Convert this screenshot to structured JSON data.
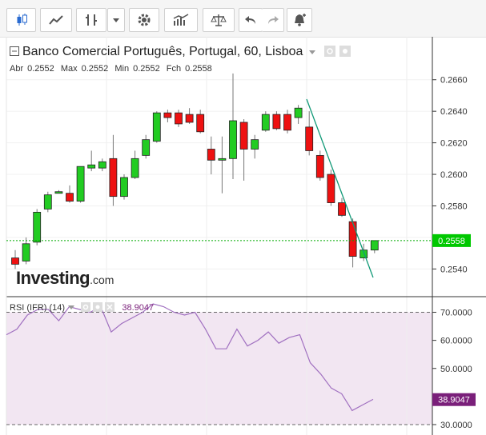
{
  "toolbar": {
    "buttons": [
      {
        "name": "candlestick-icon"
      },
      {
        "name": "line-chart-icon"
      },
      {
        "name": "bar-type-icon"
      },
      {
        "name": "chevron-down-icon"
      },
      {
        "name": "gear-icon"
      },
      {
        "name": "indicators-icon"
      },
      {
        "name": "scale-icon"
      },
      {
        "name": "undo-icon"
      },
      {
        "name": "redo-icon"
      },
      {
        "name": "alert-bell-icon"
      }
    ]
  },
  "header": {
    "title": "Banco Comercial Português, Portugal, 60, Lisboa",
    "ohlc": {
      "open_label": "Abr",
      "open": "0.2552",
      "high_label": "Max",
      "high": "0.2552",
      "low_label": "Min",
      "low": "0.2552",
      "close_label": "Fch",
      "close": "0.2558"
    }
  },
  "logo": {
    "text": "Investing",
    "suffix": ".com"
  },
  "rsi": {
    "label": "RSI (IFR) (14)",
    "value": "38.9047"
  },
  "colors": {
    "up": "#22cc22",
    "down": "#ee1111",
    "rsi_line": "#a070c0",
    "rsi_band": "#f2e6f2",
    "price_line": "#00aa00",
    "trend_line": "#119977",
    "rsi_badge": "#7a1f7a",
    "price_badge": "#00c800"
  },
  "chart_data": [
    {
      "type": "candlestick",
      "title": "Banco Comercial Português, Portugal, 60, Lisboa",
      "ylim": [
        0.2527,
        0.267
      ],
      "yticks": [
        "0.2540",
        "0.2560",
        "0.2580",
        "0.2600",
        "0.2620",
        "0.2640",
        "0.2660"
      ],
      "current_price": "0.2558",
      "candles": [
        {
          "o": 0.2547,
          "h": 0.2552,
          "l": 0.254,
          "c": 0.2543
        },
        {
          "o": 0.2545,
          "h": 0.256,
          "l": 0.2543,
          "c": 0.2556
        },
        {
          "o": 0.2557,
          "h": 0.2578,
          "l": 0.2555,
          "c": 0.2576
        },
        {
          "o": 0.2578,
          "h": 0.2589,
          "l": 0.2576,
          "c": 0.2587
        },
        {
          "o": 0.2589,
          "h": 0.259,
          "l": 0.2588,
          "c": 0.2589
        },
        {
          "o": 0.2588,
          "h": 0.2593,
          "l": 0.2582,
          "c": 0.2583
        },
        {
          "o": 0.2583,
          "h": 0.2605,
          "l": 0.2582,
          "c": 0.2605
        },
        {
          "o": 0.2604,
          "h": 0.2615,
          "l": 0.2602,
          "c": 0.2606
        },
        {
          "o": 0.2604,
          "h": 0.261,
          "l": 0.2602,
          "c": 0.2608
        },
        {
          "o": 0.261,
          "h": 0.2625,
          "l": 0.258,
          "c": 0.2586
        },
        {
          "o": 0.2586,
          "h": 0.26,
          "l": 0.2584,
          "c": 0.2598
        },
        {
          "o": 0.2598,
          "h": 0.2615,
          "l": 0.2597,
          "c": 0.261
        },
        {
          "o": 0.2612,
          "h": 0.2625,
          "l": 0.261,
          "c": 0.2622
        },
        {
          "o": 0.2621,
          "h": 0.264,
          "l": 0.262,
          "c": 0.2639
        },
        {
          "o": 0.2639,
          "h": 0.2641,
          "l": 0.2633,
          "c": 0.2636
        },
        {
          "o": 0.2639,
          "h": 0.2641,
          "l": 0.263,
          "c": 0.2632
        },
        {
          "o": 0.2638,
          "h": 0.2642,
          "l": 0.2632,
          "c": 0.2633
        },
        {
          "o": 0.2638,
          "h": 0.2641,
          "l": 0.2626,
          "c": 0.2627
        },
        {
          "o": 0.2616,
          "h": 0.2624,
          "l": 0.26,
          "c": 0.2609
        },
        {
          "o": 0.2609,
          "h": 0.2624,
          "l": 0.2588,
          "c": 0.261
        },
        {
          "o": 0.261,
          "h": 0.2664,
          "l": 0.2597,
          "c": 0.2634
        },
        {
          "o": 0.2633,
          "h": 0.2635,
          "l": 0.2596,
          "c": 0.2616
        },
        {
          "o": 0.2616,
          "h": 0.2625,
          "l": 0.261,
          "c": 0.2622
        },
        {
          "o": 0.2628,
          "h": 0.264,
          "l": 0.2627,
          "c": 0.2638
        },
        {
          "o": 0.2638,
          "h": 0.264,
          "l": 0.2628,
          "c": 0.2629
        },
        {
          "o": 0.2638,
          "h": 0.2641,
          "l": 0.2626,
          "c": 0.2628
        },
        {
          "o": 0.2636,
          "h": 0.2644,
          "l": 0.2632,
          "c": 0.2642
        },
        {
          "o": 0.263,
          "h": 0.264,
          "l": 0.2612,
          "c": 0.2615
        },
        {
          "o": 0.2612,
          "h": 0.2615,
          "l": 0.2596,
          "c": 0.2598
        },
        {
          "o": 0.26,
          "h": 0.2603,
          "l": 0.258,
          "c": 0.2582
        },
        {
          "o": 0.2582,
          "h": 0.2585,
          "l": 0.2573,
          "c": 0.2574
        },
        {
          "o": 0.257,
          "h": 0.2572,
          "l": 0.2541,
          "c": 0.2548
        },
        {
          "o": 0.2547,
          "h": 0.2556,
          "l": 0.2545,
          "c": 0.2552
        },
        {
          "o": 0.2552,
          "h": 0.2558,
          "l": 0.255,
          "c": 0.2558
        }
      ]
    },
    {
      "type": "line",
      "title": "RSI (IFR) (14)",
      "ylim": [
        28,
        73
      ],
      "yticks": [
        "30.0000",
        "40.0000",
        "50.0000",
        "60.0000",
        "70.0000"
      ],
      "bands": [
        30,
        70
      ],
      "current_value": "38.9047",
      "values": [
        62,
        64,
        69,
        71,
        71,
        67,
        72,
        71,
        70,
        72,
        63,
        66,
        68,
        70,
        73,
        72,
        70,
        69,
        70,
        64,
        57,
        57,
        64,
        58,
        60,
        63,
        59,
        61,
        62,
        52,
        48,
        43,
        41,
        35,
        37,
        39
      ]
    }
  ]
}
